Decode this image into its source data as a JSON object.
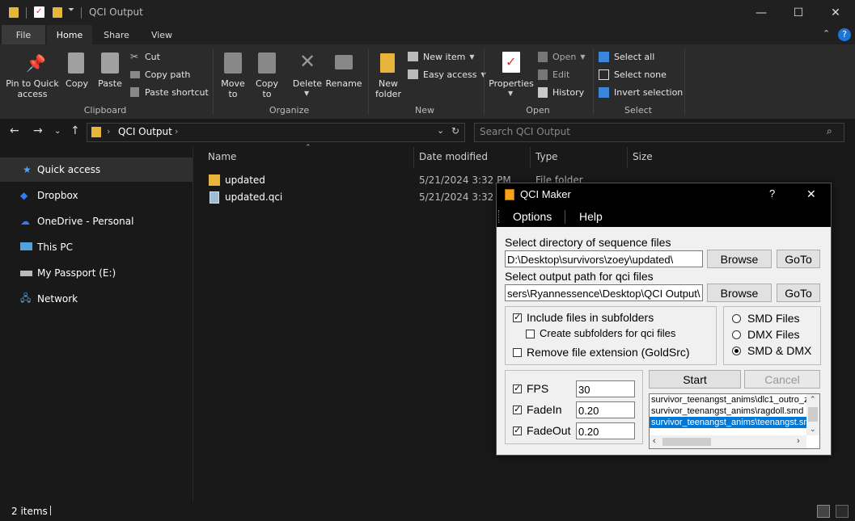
{
  "window": {
    "title": "QCI Output",
    "min": "—",
    "max": "☐",
    "close": "✕"
  },
  "ribbon_tabs": [
    "File",
    "Home",
    "Share",
    "View"
  ],
  "clipboard": {
    "pin": "Pin to Quick access",
    "copy": "Copy",
    "paste": "Paste",
    "cut": "Cut",
    "copy_path": "Copy path",
    "paste_shortcut": "Paste shortcut",
    "label": "Clipboard"
  },
  "organize": {
    "move_to": "Move to",
    "copy_to": "Copy to",
    "delete": "Delete",
    "rename": "Rename",
    "label": "Organize"
  },
  "new": {
    "new_folder": "New folder",
    "new_item": "New item",
    "easy_access": "Easy access",
    "label": "New"
  },
  "open": {
    "properties": "Properties",
    "open": "Open",
    "edit": "Edit",
    "history": "History",
    "label": "Open"
  },
  "select": {
    "select_all": "Select all",
    "select_none": "Select none",
    "invert": "Invert selection",
    "label": "Select"
  },
  "address": {
    "path": "QCI Output",
    "search_placeholder": "Search QCI Output"
  },
  "nav": [
    "Quick access",
    "Dropbox",
    "OneDrive - Personal",
    "This PC",
    "My Passport (E:)",
    "Network"
  ],
  "columns": {
    "name": "Name",
    "date": "Date modified",
    "type": "Type",
    "size": "Size"
  },
  "files": [
    {
      "name": "updated",
      "date": "5/21/2024 3:32 PM",
      "type": "File folder"
    },
    {
      "name": "updated.qci",
      "date": "5/21/2024 3:32 PM",
      "type": ""
    }
  ],
  "status": {
    "items": "2 items"
  },
  "qci": {
    "title": "QCI Maker",
    "help_btn": "?",
    "close_btn": "✕",
    "menu": [
      "Options",
      "Help"
    ],
    "seq_label": "Select directory of sequence files",
    "seq_path": "D:\\Desktop\\survivors\\zoey\\updated\\",
    "out_label": "Select output path for qci files",
    "out_path": "sers\\Ryannessence\\Desktop\\QCI Output\\",
    "browse": "Browse",
    "goto": "GoTo",
    "include_sub": "Include files in subfolders",
    "create_sub": "Create subfolders for qci files",
    "remove_ext": "Remove file extension (GoldSrc)",
    "smd": "SMD Files",
    "dmx": "DMX Files",
    "smd_dmx": "SMD & DMX",
    "fps_label": "FPS",
    "fps": "30",
    "fadein_label": "FadeIn",
    "fadein": "0.20",
    "fadeout_label": "FadeOut",
    "fadeout": "0.20",
    "start": "Start",
    "cancel": "Cancel",
    "list": [
      "survivor_teenangst_anims\\dlc1_outro_z",
      "survivor_teenangst_anims\\ragdoll.smd",
      "survivor_teenangst_anims\\teenangst.sm"
    ]
  },
  "colors": {
    "accent": "#0078d7",
    "folder": "#e8b43c",
    "dark_bg": "#191919"
  }
}
